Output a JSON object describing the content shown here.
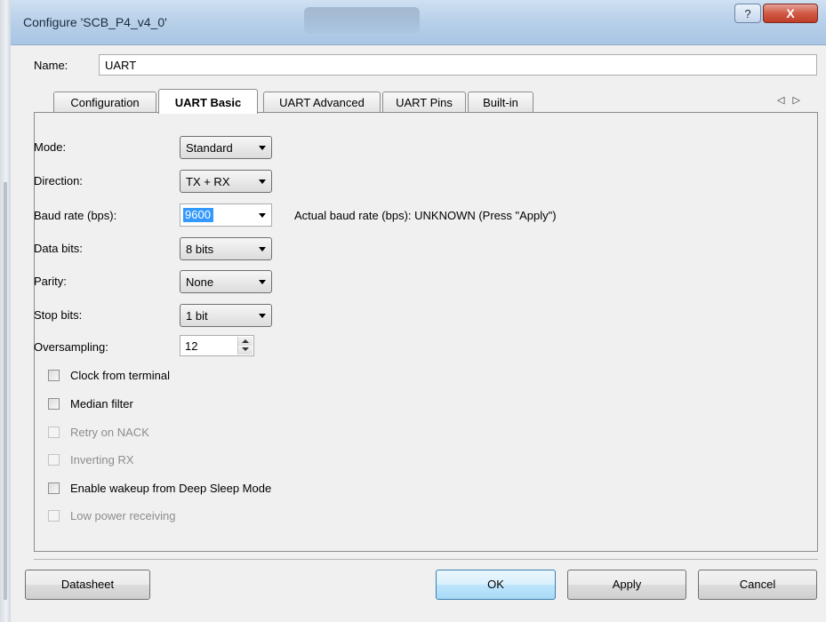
{
  "window": {
    "title": "Configure 'SCB_P4_v4_0'",
    "help_label": "?",
    "close_label": "X"
  },
  "name": {
    "label": "Name:",
    "value": "UART"
  },
  "tabs": [
    {
      "label": "Configuration",
      "active": false
    },
    {
      "label": "UART Basic",
      "active": true
    },
    {
      "label": "UART Advanced",
      "active": false
    },
    {
      "label": "UART Pins",
      "active": false
    },
    {
      "label": "Built-in",
      "active": false
    }
  ],
  "tab_scroll_label": "◁ ▷",
  "fields": {
    "mode": {
      "label": "Mode:",
      "value": "Standard"
    },
    "direction": {
      "label": "Direction:",
      "value": "TX + RX"
    },
    "baud_rate": {
      "label": "Baud rate (bps):",
      "value": "9600",
      "note": "Actual baud rate (bps): UNKNOWN (Press \"Apply\")"
    },
    "data_bits": {
      "label": "Data bits:",
      "value": "8 bits"
    },
    "parity": {
      "label": "Parity:",
      "value": "None"
    },
    "stop_bits": {
      "label": "Stop bits:",
      "value": "1 bit"
    },
    "oversampling": {
      "label": "Oversampling:",
      "value": "12"
    }
  },
  "checkboxes": [
    {
      "label": "Clock from terminal",
      "checked": false,
      "enabled": true
    },
    {
      "label": "Median filter",
      "checked": false,
      "enabled": true
    },
    {
      "label": "Retry on NACK",
      "checked": false,
      "enabled": false
    },
    {
      "label": "Inverting RX",
      "checked": false,
      "enabled": false
    },
    {
      "label": "Enable wakeup from Deep Sleep Mode",
      "checked": false,
      "enabled": true
    },
    {
      "label": "Low power receiving",
      "checked": false,
      "enabled": false
    }
  ],
  "buttons": {
    "datasheet": "Datasheet",
    "ok": "OK",
    "apply": "Apply",
    "cancel": "Cancel"
  }
}
